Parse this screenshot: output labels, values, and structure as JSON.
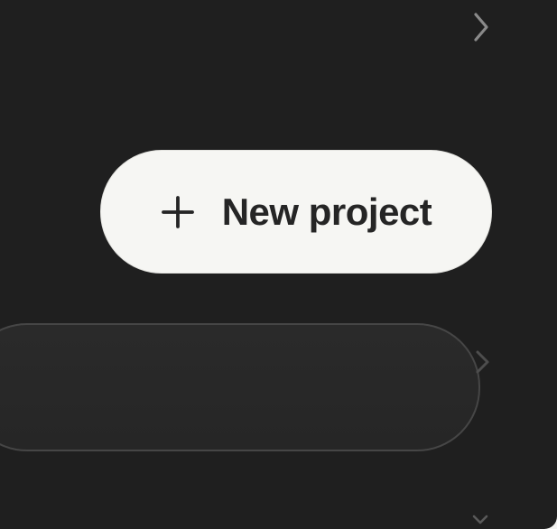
{
  "primary_action": {
    "label": "New project",
    "icon": "plus-icon"
  },
  "icons": {
    "top_chevron": "chevron-right-icon",
    "middle_chevron": "chevron-right-icon",
    "bottom_chevron": "chevron-down-icon"
  },
  "colors": {
    "panel_background": "#1f1f1f",
    "button_background": "#f6f6f3",
    "button_text": "#252525",
    "field_border": "#464646",
    "chevron": "#8a8a8a"
  }
}
